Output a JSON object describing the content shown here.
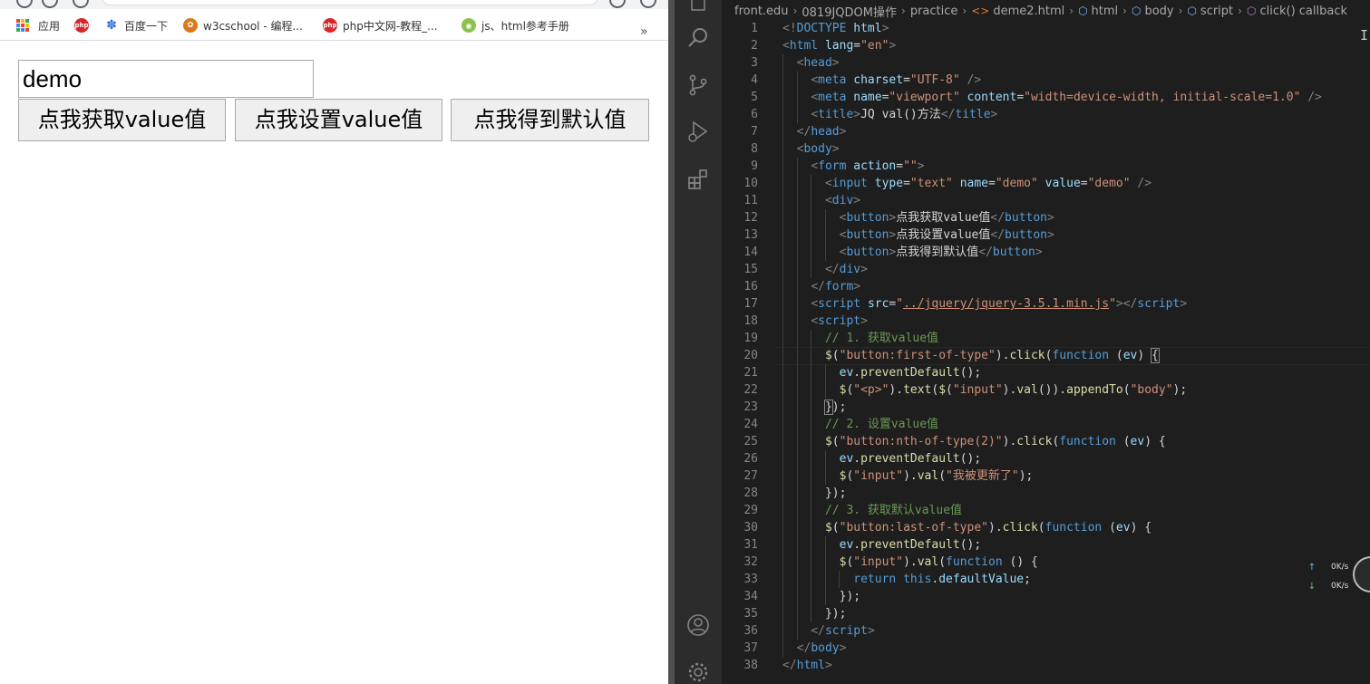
{
  "browser": {
    "bookmarks": [
      {
        "label": "应用",
        "icon": "apps-grid-icon"
      },
      {
        "label": "",
        "icon": "php-site-icon",
        "icon_text": "php"
      },
      {
        "label": "百度一下",
        "icon": "baidu-paw-icon"
      },
      {
        "label": "w3cschool - 编程...",
        "icon": "w3cschool-icon"
      },
      {
        "label": "php中文网-教程_...",
        "icon": "php-site-icon",
        "icon_text": "php"
      },
      {
        "label": "js、html参考手册",
        "icon": "reference-icon"
      }
    ],
    "more_label": "»",
    "page": {
      "input_value": "demo",
      "buttons": [
        "点我获取value值",
        "点我设置value值",
        "点我得到默认值"
      ]
    }
  },
  "vscode": {
    "breadcrumb": [
      "front.edu",
      "0819JQDOM操作",
      "practice",
      "deme2.html",
      "html",
      "body",
      "script",
      "click() callback"
    ],
    "activity_icons": [
      "explorer-icon",
      "search-icon",
      "source-control-icon",
      "run-debug-icon",
      "extensions-icon",
      "account-icon",
      "settings-gear-icon"
    ],
    "net_widget": {
      "up": "0K/s",
      "down": "0K/s"
    },
    "code_lines": [
      [
        [
          "punct",
          "<!"
        ],
        [
          "tag",
          "DOCTYPE"
        ],
        [
          "text",
          " "
        ],
        [
          "attr",
          "html"
        ],
        [
          "punct",
          ">"
        ]
      ],
      [
        [
          "punct",
          "<"
        ],
        [
          "tag",
          "html"
        ],
        [
          "text",
          " "
        ],
        [
          "attr",
          "lang"
        ],
        [
          "text",
          "="
        ],
        [
          "str",
          "\"en\""
        ],
        [
          "punct",
          ">"
        ]
      ],
      [
        [
          "text",
          "  "
        ],
        [
          "punct",
          "<"
        ],
        [
          "tag",
          "head"
        ],
        [
          "punct",
          ">"
        ]
      ],
      [
        [
          "text",
          "    "
        ],
        [
          "punct",
          "<"
        ],
        [
          "tag",
          "meta"
        ],
        [
          "text",
          " "
        ],
        [
          "attr",
          "charset"
        ],
        [
          "text",
          "="
        ],
        [
          "str",
          "\"UTF-8\""
        ],
        [
          "text",
          " "
        ],
        [
          "punct",
          "/>"
        ]
      ],
      [
        [
          "text",
          "    "
        ],
        [
          "punct",
          "<"
        ],
        [
          "tag",
          "meta"
        ],
        [
          "text",
          " "
        ],
        [
          "attr",
          "name"
        ],
        [
          "text",
          "="
        ],
        [
          "str",
          "\"viewport\""
        ],
        [
          "text",
          " "
        ],
        [
          "attr",
          "content"
        ],
        [
          "text",
          "="
        ],
        [
          "str",
          "\"width=device-width, initial-scale=1.0\""
        ],
        [
          "text",
          " "
        ],
        [
          "punct",
          "/>"
        ]
      ],
      [
        [
          "text",
          "    "
        ],
        [
          "punct",
          "<"
        ],
        [
          "tag",
          "title"
        ],
        [
          "punct",
          ">"
        ],
        [
          "text",
          "JQ val()方法"
        ],
        [
          "punct",
          "</"
        ],
        [
          "tag",
          "title"
        ],
        [
          "punct",
          ">"
        ]
      ],
      [
        [
          "text",
          "  "
        ],
        [
          "punct",
          "</"
        ],
        [
          "tag",
          "head"
        ],
        [
          "punct",
          ">"
        ]
      ],
      [
        [
          "text",
          "  "
        ],
        [
          "punct",
          "<"
        ],
        [
          "tag",
          "body"
        ],
        [
          "punct",
          ">"
        ]
      ],
      [
        [
          "text",
          "    "
        ],
        [
          "punct",
          "<"
        ],
        [
          "tag",
          "form"
        ],
        [
          "text",
          " "
        ],
        [
          "attr",
          "action"
        ],
        [
          "text",
          "="
        ],
        [
          "str",
          "\"\""
        ],
        [
          "punct",
          ">"
        ]
      ],
      [
        [
          "text",
          "      "
        ],
        [
          "punct",
          "<"
        ],
        [
          "tag",
          "input"
        ],
        [
          "text",
          " "
        ],
        [
          "attr",
          "type"
        ],
        [
          "text",
          "="
        ],
        [
          "str",
          "\"text\""
        ],
        [
          "text",
          " "
        ],
        [
          "attr",
          "name"
        ],
        [
          "text",
          "="
        ],
        [
          "str",
          "\"demo\""
        ],
        [
          "text",
          " "
        ],
        [
          "attr",
          "value"
        ],
        [
          "text",
          "="
        ],
        [
          "str",
          "\"demo\""
        ],
        [
          "text",
          " "
        ],
        [
          "punct",
          "/>"
        ]
      ],
      [
        [
          "text",
          "      "
        ],
        [
          "punct",
          "<"
        ],
        [
          "tag",
          "div"
        ],
        [
          "punct",
          ">"
        ]
      ],
      [
        [
          "text",
          "        "
        ],
        [
          "punct",
          "<"
        ],
        [
          "tag",
          "button"
        ],
        [
          "punct",
          ">"
        ],
        [
          "text",
          "点我获取value值"
        ],
        [
          "punct",
          "</"
        ],
        [
          "tag",
          "button"
        ],
        [
          "punct",
          ">"
        ]
      ],
      [
        [
          "text",
          "        "
        ],
        [
          "punct",
          "<"
        ],
        [
          "tag",
          "button"
        ],
        [
          "punct",
          ">"
        ],
        [
          "text",
          "点我设置value值"
        ],
        [
          "punct",
          "</"
        ],
        [
          "tag",
          "button"
        ],
        [
          "punct",
          ">"
        ]
      ],
      [
        [
          "text",
          "        "
        ],
        [
          "punct",
          "<"
        ],
        [
          "tag",
          "button"
        ],
        [
          "punct",
          ">"
        ],
        [
          "text",
          "点我得到默认值"
        ],
        [
          "punct",
          "</"
        ],
        [
          "tag",
          "button"
        ],
        [
          "punct",
          ">"
        ]
      ],
      [
        [
          "text",
          "      "
        ],
        [
          "punct",
          "</"
        ],
        [
          "tag",
          "div"
        ],
        [
          "punct",
          ">"
        ]
      ],
      [
        [
          "text",
          "    "
        ],
        [
          "punct",
          "</"
        ],
        [
          "tag",
          "form"
        ],
        [
          "punct",
          ">"
        ]
      ],
      [
        [
          "text",
          "    "
        ],
        [
          "punct",
          "<"
        ],
        [
          "tag",
          "script"
        ],
        [
          "text",
          " "
        ],
        [
          "attr",
          "src"
        ],
        [
          "text",
          "="
        ],
        [
          "str",
          "\""
        ],
        [
          "link",
          "../jquery/jquery-3.5.1.min.js"
        ],
        [
          "str",
          "\""
        ],
        [
          "punct",
          "></"
        ],
        [
          "tag",
          "script"
        ],
        [
          "punct",
          ">"
        ]
      ],
      [
        [
          "text",
          "    "
        ],
        [
          "punct",
          "<"
        ],
        [
          "tag",
          "script"
        ],
        [
          "punct",
          ">"
        ]
      ],
      [
        [
          "text",
          "      "
        ],
        [
          "com",
          "// 1. 获取value值"
        ]
      ],
      [
        [
          "text",
          "      "
        ],
        [
          "fn",
          "$"
        ],
        [
          "text",
          "("
        ],
        [
          "str",
          "\"button:first-of-type\""
        ],
        [
          "text",
          ")."
        ],
        [
          "fn",
          "click"
        ],
        [
          "text",
          "("
        ],
        [
          "kw",
          "function"
        ],
        [
          "text",
          " ("
        ],
        [
          "var",
          "ev"
        ],
        [
          "text",
          ") "
        ],
        [
          "bracket",
          "{"
        ]
      ],
      [
        [
          "text",
          "        "
        ],
        [
          "var",
          "ev"
        ],
        [
          "text",
          "."
        ],
        [
          "fn",
          "preventDefault"
        ],
        [
          "text",
          "();"
        ]
      ],
      [
        [
          "text",
          "        "
        ],
        [
          "fn",
          "$"
        ],
        [
          "text",
          "("
        ],
        [
          "str",
          "\"<p>\""
        ],
        [
          "text",
          ")."
        ],
        [
          "fn",
          "text"
        ],
        [
          "text",
          "("
        ],
        [
          "fn",
          "$"
        ],
        [
          "text",
          "("
        ],
        [
          "str",
          "\"input\""
        ],
        [
          "text",
          ")."
        ],
        [
          "fn",
          "val"
        ],
        [
          "text",
          "())."
        ],
        [
          "fn",
          "appendTo"
        ],
        [
          "text",
          "("
        ],
        [
          "str",
          "\"body\""
        ],
        [
          "text",
          ");"
        ]
      ],
      [
        [
          "text",
          "      "
        ],
        [
          "bracket",
          "}"
        ],
        [
          "text",
          ");"
        ]
      ],
      [
        [
          "text",
          "      "
        ],
        [
          "com",
          "// 2. 设置value值"
        ]
      ],
      [
        [
          "text",
          "      "
        ],
        [
          "fn",
          "$"
        ],
        [
          "text",
          "("
        ],
        [
          "str",
          "\"button:nth-of-type(2)\""
        ],
        [
          "text",
          ")."
        ],
        [
          "fn",
          "click"
        ],
        [
          "text",
          "("
        ],
        [
          "kw",
          "function"
        ],
        [
          "text",
          " ("
        ],
        [
          "var",
          "ev"
        ],
        [
          "text",
          ") {"
        ]
      ],
      [
        [
          "text",
          "        "
        ],
        [
          "var",
          "ev"
        ],
        [
          "text",
          "."
        ],
        [
          "fn",
          "preventDefault"
        ],
        [
          "text",
          "();"
        ]
      ],
      [
        [
          "text",
          "        "
        ],
        [
          "fn",
          "$"
        ],
        [
          "text",
          "("
        ],
        [
          "str",
          "\"input\""
        ],
        [
          "text",
          ")."
        ],
        [
          "fn",
          "val"
        ],
        [
          "text",
          "("
        ],
        [
          "str",
          "\"我被更新了\""
        ],
        [
          "text",
          ");"
        ]
      ],
      [
        [
          "text",
          "      "
        ],
        [
          "text",
          "});"
        ]
      ],
      [
        [
          "text",
          "      "
        ],
        [
          "com",
          "// 3. 获取默认value值"
        ]
      ],
      [
        [
          "text",
          "      "
        ],
        [
          "fn",
          "$"
        ],
        [
          "text",
          "("
        ],
        [
          "str",
          "\"button:last-of-type\""
        ],
        [
          "text",
          ")."
        ],
        [
          "fn",
          "click"
        ],
        [
          "text",
          "("
        ],
        [
          "kw",
          "function"
        ],
        [
          "text",
          " ("
        ],
        [
          "var",
          "ev"
        ],
        [
          "text",
          ") {"
        ]
      ],
      [
        [
          "text",
          "        "
        ],
        [
          "var",
          "ev"
        ],
        [
          "text",
          "."
        ],
        [
          "fn",
          "preventDefault"
        ],
        [
          "text",
          "();"
        ]
      ],
      [
        [
          "text",
          "        "
        ],
        [
          "fn",
          "$"
        ],
        [
          "text",
          "("
        ],
        [
          "str",
          "\"input\""
        ],
        [
          "text",
          ")."
        ],
        [
          "fn",
          "val"
        ],
        [
          "text",
          "("
        ],
        [
          "kw",
          "function"
        ],
        [
          "text",
          " () {"
        ]
      ],
      [
        [
          "text",
          "          "
        ],
        [
          "kw",
          "return"
        ],
        [
          "text",
          " "
        ],
        [
          "kw",
          "this"
        ],
        [
          "text",
          "."
        ],
        [
          "var",
          "defaultValue"
        ],
        [
          "text",
          ";"
        ]
      ],
      [
        [
          "text",
          "        "
        ],
        [
          "text",
          "});"
        ]
      ],
      [
        [
          "text",
          "      "
        ],
        [
          "text",
          "});"
        ]
      ],
      [
        [
          "text",
          "    "
        ],
        [
          "punct",
          "</"
        ],
        [
          "tag",
          "script"
        ],
        [
          "punct",
          ">"
        ]
      ],
      [
        [
          "text",
          "  "
        ],
        [
          "punct",
          "</"
        ],
        [
          "tag",
          "body"
        ],
        [
          "punct",
          ">"
        ]
      ],
      [
        [
          "punct",
          "</"
        ],
        [
          "tag",
          "html"
        ],
        [
          "punct",
          ">"
        ]
      ]
    ],
    "colors": {
      "editor_bg": "#1e1e1e",
      "activity_bg": "#2c2c2c",
      "tag": "#569cd6",
      "attr": "#9cdcfe",
      "string": "#ce9178",
      "comment": "#6a9955",
      "function": "#dcdcaa"
    }
  }
}
